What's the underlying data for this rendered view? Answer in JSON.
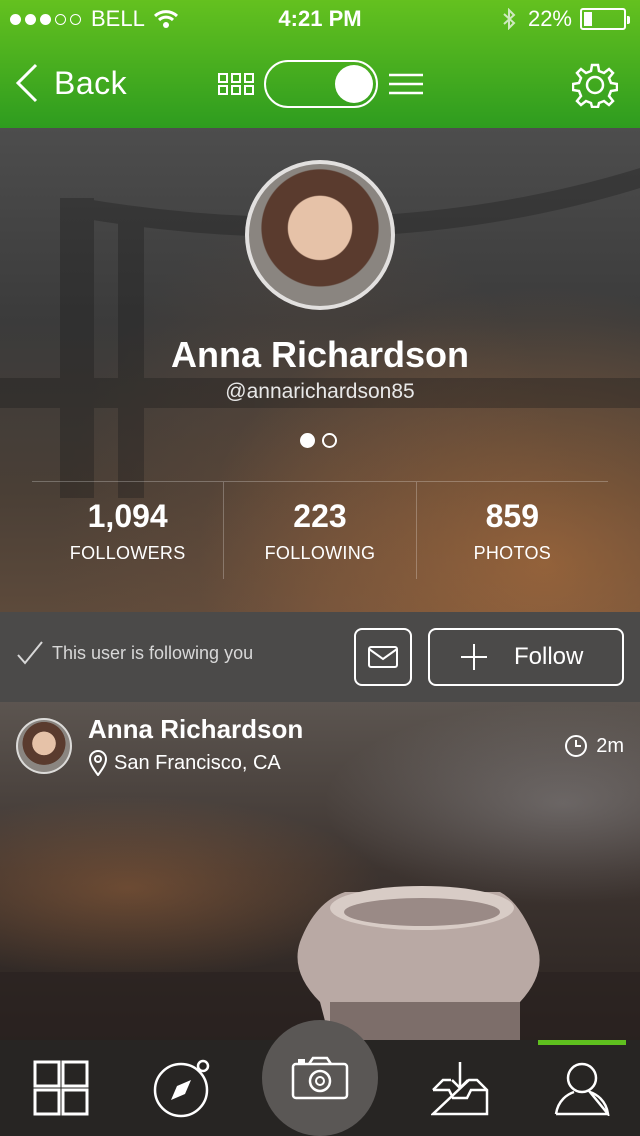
{
  "status_bar": {
    "carrier": "BELL",
    "time": "4:21 PM",
    "battery": "22%"
  },
  "nav": {
    "back_label": "Back"
  },
  "profile": {
    "name": "Anna Richardson",
    "handle": "@annarichardson85",
    "pager": {
      "current": 1,
      "total": 2
    },
    "stats": [
      {
        "value": "1,094",
        "label": "FOLLOWERS"
      },
      {
        "value": "223",
        "label": "FOLLOWING"
      },
      {
        "value": "859",
        "label": "PHOTOS"
      }
    ]
  },
  "actions": {
    "following_note": "This user is following you",
    "follow_label": "Follow"
  },
  "post": {
    "author": "Anna Richardson",
    "location": "San Francisco, CA",
    "time": "2m"
  },
  "colors": {
    "accent": "#5fbf1f",
    "header_top": "#64c11f",
    "header_bottom": "#2e9c1f"
  },
  "tabs": [
    {
      "icon": "grid-icon"
    },
    {
      "icon": "compass-icon"
    },
    {
      "icon": "camera-icon"
    },
    {
      "icon": "inbox-download-icon"
    },
    {
      "icon": "profile-icon",
      "active": true
    }
  ]
}
